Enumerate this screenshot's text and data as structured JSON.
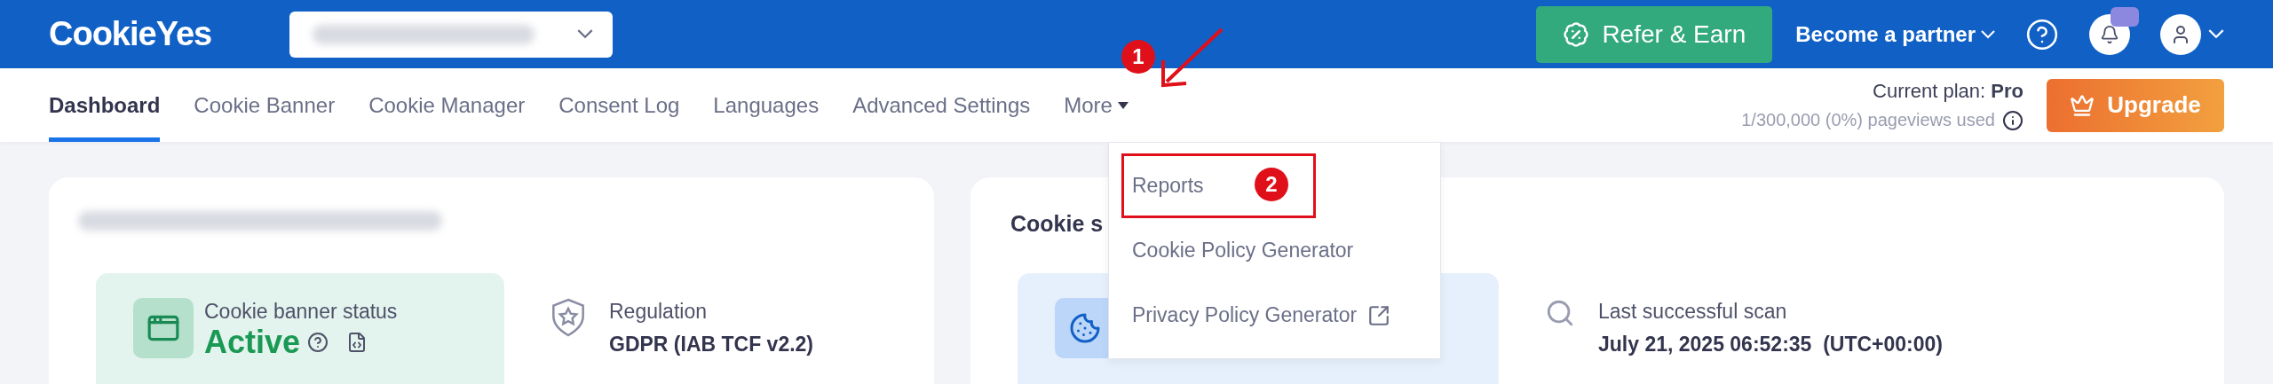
{
  "header": {
    "logo": "CookieYes",
    "refer_button": "Refer & Earn",
    "partner_link": "Become a partner"
  },
  "nav": {
    "tabs": [
      {
        "label": "Dashboard",
        "selected": true
      },
      {
        "label": "Cookie Banner",
        "selected": false
      },
      {
        "label": "Cookie Manager",
        "selected": false
      },
      {
        "label": "Consent Log",
        "selected": false
      },
      {
        "label": "Languages",
        "selected": false
      },
      {
        "label": "Advanced Settings",
        "selected": false
      },
      {
        "label": "More",
        "selected": false,
        "kind": "dropdown"
      }
    ]
  },
  "plan": {
    "label": "Current plan:",
    "value": "Pro",
    "usage": "1/300,000 (0%) pageviews used"
  },
  "upgrade_button": "Upgrade",
  "menu": {
    "items": [
      {
        "label": "Reports",
        "kind": "link",
        "highlighted": true
      },
      {
        "label": "Cookie Policy Generator",
        "kind": "link",
        "highlighted": false
      },
      {
        "label": "Privacy Policy Generator",
        "kind": "external",
        "highlighted": false
      }
    ]
  },
  "annotations": [
    "1",
    "2"
  ],
  "cards": [
    {
      "title": {
        "kind": "redacted"
      },
      "status": {
        "label": "Cookie banner status",
        "value": "Active"
      },
      "info": {
        "label": "Regulation",
        "value": "GDPR (IAB TCF v2.2)"
      }
    },
    {
      "title": "Cookie s",
      "info": {
        "label": "Last successful scan",
        "value": "July 21, 2025 06:52:35  (UTC+00:00)"
      }
    }
  ]
}
